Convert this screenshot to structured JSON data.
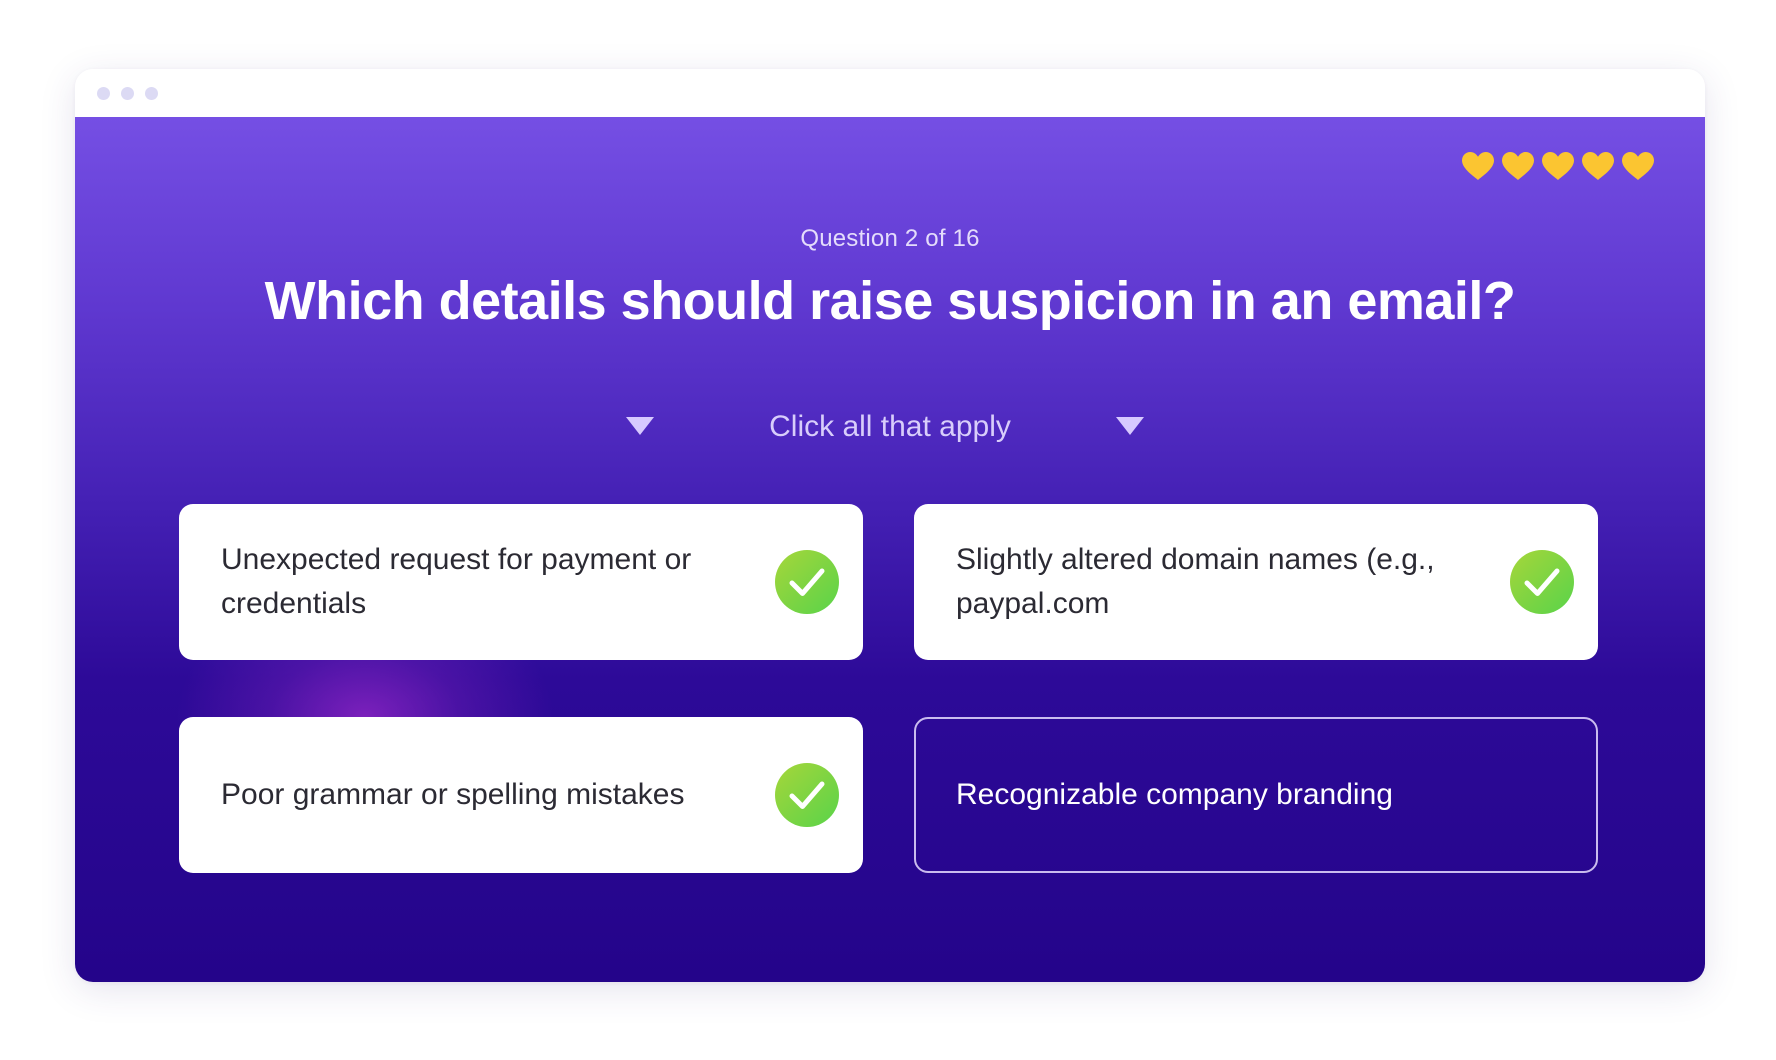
{
  "quiz": {
    "counter": "Question 2 of 16",
    "question": "Which details should raise suspicion in an email?",
    "instruction": "Click all that apply",
    "lives": 5,
    "heart_color": "#fbc531",
    "options": [
      {
        "label": "Unexpected request for payment or credentials",
        "selected": true
      },
      {
        "label": "Slightly altered domain names (e.g., paypal.com",
        "selected": true
      },
      {
        "label": "Poor grammar or spelling mistakes",
        "selected": true
      },
      {
        "label": "Recognizable company branding",
        "selected": false
      }
    ]
  },
  "colors": {
    "accent_top": "#754fe4",
    "accent_bottom": "#24048a",
    "check_green": "#59d34a"
  }
}
